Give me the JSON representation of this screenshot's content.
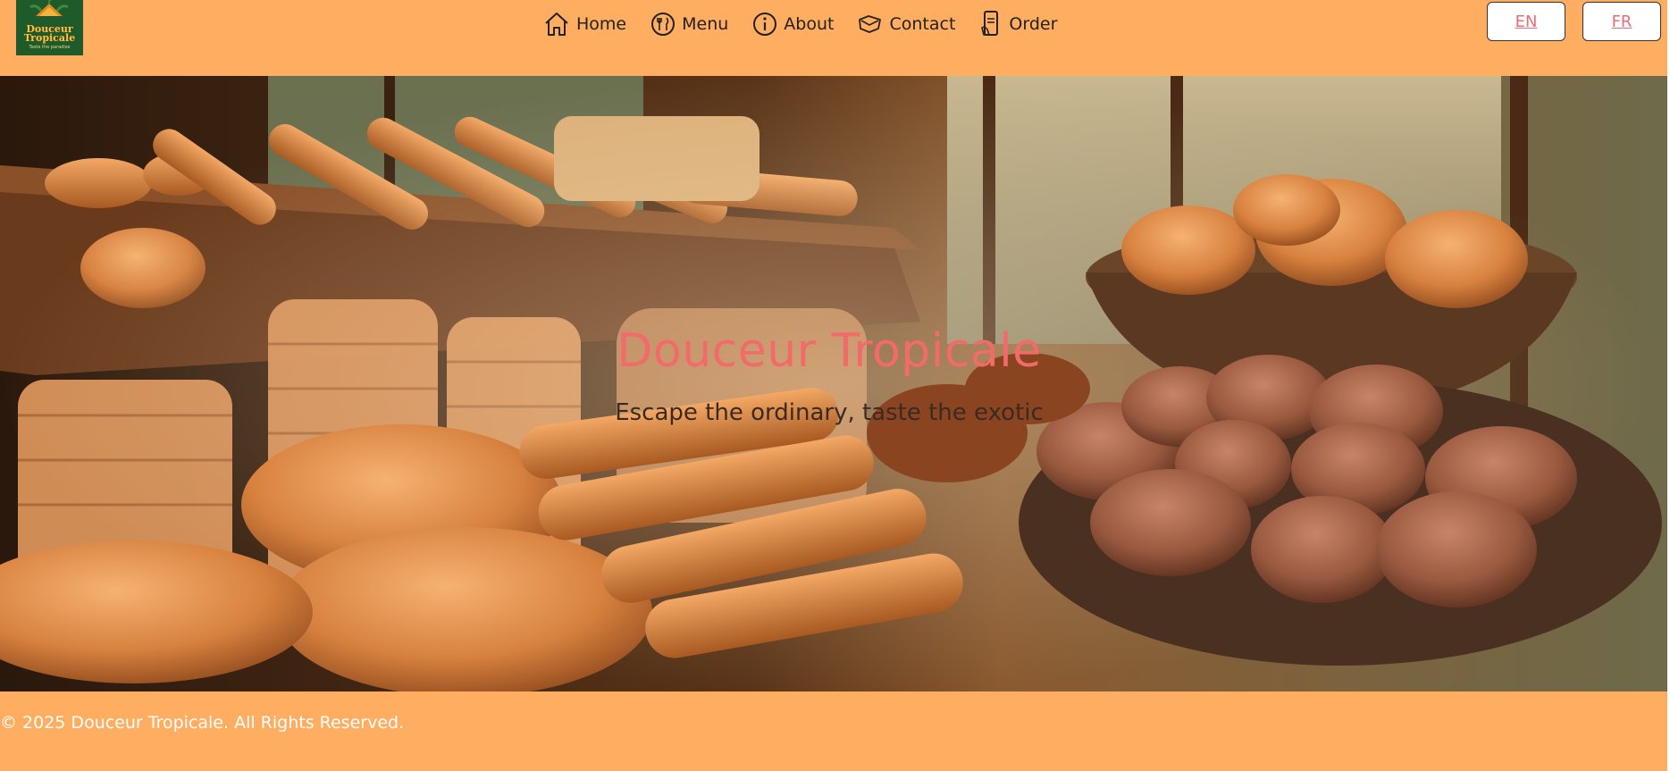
{
  "nav": {
    "logo_name": "Douceur Tropicale",
    "logo_text_line1": "Douceur",
    "logo_text_line2": "Tropicale",
    "logo_subtitle": "Taste the paradise",
    "items": [
      {
        "label": "Home",
        "icon": "home-icon"
      },
      {
        "label": "Menu",
        "icon": "plate-utensils-icon"
      },
      {
        "label": "About",
        "icon": "info-icon"
      },
      {
        "label": "Contact",
        "icon": "phone-hand-icon"
      },
      {
        "label": "Order",
        "icon": "mobile-order-icon"
      }
    ],
    "languages": [
      {
        "label": "EN"
      },
      {
        "label": "FR"
      }
    ]
  },
  "hero": {
    "title": "Douceur Tropicale",
    "tagline": "Escape the ordinary, taste the exotic"
  },
  "footer": {
    "copyright": "© 2025 Douceur Tropicale. All Rights Reserved."
  },
  "colors": {
    "header_bg": "#ffad60",
    "title": "#f26b6b",
    "lang_link": "#f06b7a",
    "footer_text": "#ffffff"
  }
}
